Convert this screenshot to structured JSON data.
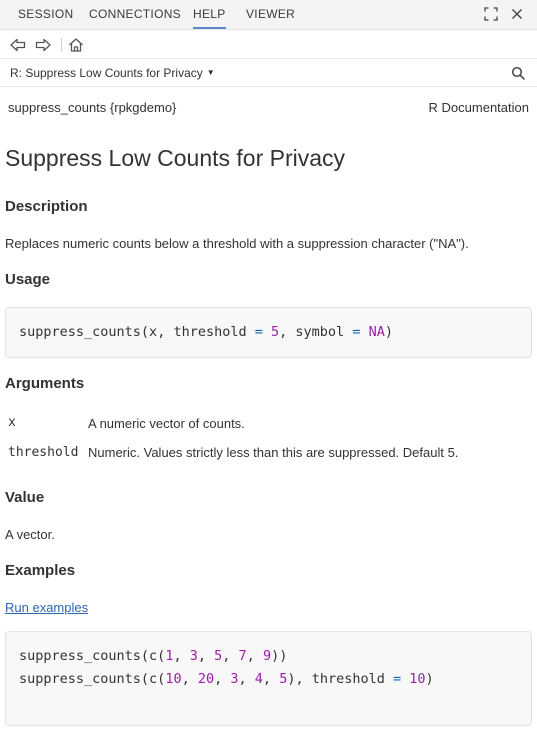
{
  "tabs": [
    {
      "label": "SESSION",
      "active": false
    },
    {
      "label": "CONNECTIONS",
      "active": false
    },
    {
      "label": "HELP",
      "active": true
    },
    {
      "label": "VIEWER",
      "active": false
    }
  ],
  "icons": {
    "expand": "expand-icon",
    "close": "close-icon",
    "back": "back-arrow-icon",
    "forward": "forward-arrow-icon",
    "home": "home-icon",
    "search": "search-icon"
  },
  "topic": {
    "label": "R: Suppress Low Counts for Privacy"
  },
  "doc": {
    "package_line": "suppress_counts {rpkgdemo}",
    "r_documentation": "R Documentation",
    "title": "Suppress Low Counts for Privacy",
    "description_heading": "Description",
    "description_text": "Replaces numeric counts below a threshold with a suppression character (\"NA\").",
    "usage_heading": "Usage",
    "usage_code": {
      "fn": "suppress_counts(",
      "arg_x": "x",
      "comma1": ", ",
      "arg_threshold": "threshold",
      "eq1": " = ",
      "val_threshold": "5",
      "comma2": ", ",
      "arg_symbol": "symbol",
      "eq2": " = ",
      "val_symbol": "NA",
      "close": ")"
    },
    "arguments_heading": "Arguments",
    "arguments": [
      {
        "name": "x",
        "desc": "A numeric vector of counts."
      },
      {
        "name": "threshold",
        "desc": "Numeric. Values strictly less than this are suppressed. Default 5."
      }
    ],
    "value_heading": "Value",
    "value_text": "A vector.",
    "examples_heading": "Examples",
    "run_examples": "Run examples",
    "examples_code": {
      "line1": {
        "fn": "suppress_counts(c(",
        "v": [
          "1",
          "3",
          "5",
          "7",
          "9"
        ],
        "close": "))"
      },
      "line2": {
        "fn": "suppress_counts(c(",
        "v": [
          "10",
          "20",
          "3",
          "4",
          "5"
        ],
        "mid": "), ",
        "arg": "threshold",
        "eq": " = ",
        "val": "10",
        "close": ")"
      }
    }
  },
  "colors": {
    "accent": "#5b88c7",
    "link": "#2c68b1",
    "number": "#9b1fa6",
    "operator": "#0b65b8"
  }
}
